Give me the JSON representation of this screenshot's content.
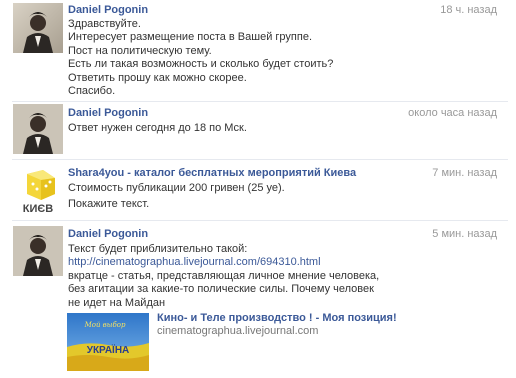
{
  "messages": [
    {
      "author": "Daniel Pogonin",
      "time": "18 ч. назад",
      "lines": [
        "Здравствуйте.",
        "Интересует размещение поста в Вашей группе.",
        "Пост на политическую тему.",
        "Есть ли такая возможность и сколько будет стоить?",
        "Ответить прошу как можно скорее.",
        "Спасибо."
      ]
    },
    {
      "author": "Daniel Pogonin",
      "time": "около часа назад",
      "lines": [
        "Ответ нужен сегодня до 18 по Мск."
      ]
    },
    {
      "author": "Shara4you - каталог бесплатных мероприятий Киева",
      "time": "7 мин. назад",
      "lines": [
        "Стоимость публикации 200 гривен (25 уе).",
        "Покажите текст."
      ]
    },
    {
      "author": "Daniel Pogonin",
      "time": "5 мин. назад",
      "lines": [
        "Текст будет приблизительно такой:",
        "http://cinematographua.livejournal.com/694310.html",
        "вкратце - статья, представляющая личное мнение человека,",
        "без агитации за какие-то полические силы. Почему человек",
        "не идет на Майдан"
      ],
      "attachment": {
        "title": "Кино- и Теле производство ! - Моя позиция!",
        "domain": "cinematographua.livejournal.com",
        "image_text_top": "Мой выбор",
        "image_text_bottom": "УКРАЇНА"
      }
    }
  ],
  "logo_text": "КИЄВ",
  "colors": {
    "link": "#3b5998",
    "time": "#999999",
    "text": "#333333",
    "divider": "#e6e9ef"
  }
}
